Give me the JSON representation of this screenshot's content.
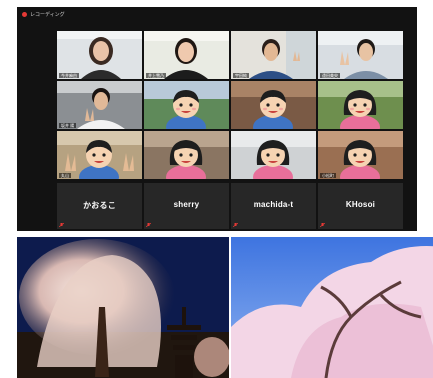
{
  "call": {
    "recording_label": "レコーディング",
    "video_tiles": [
      {
        "name": "今井麻由"
      },
      {
        "name": "井上雪乃"
      },
      {
        "name": "宇田純"
      },
      {
        "name": "遠田美央"
      },
      {
        "name": "坂井 陽"
      },
      {
        "name": ""
      },
      {
        "name": ""
      },
      {
        "name": ""
      },
      {
        "name": "丸山"
      },
      {
        "name": ""
      },
      {
        "name": ""
      },
      {
        "name": "小松町"
      }
    ],
    "name_tiles": [
      {
        "label": "かおるこ"
      },
      {
        "label": "sherry"
      },
      {
        "label": "machida-t"
      },
      {
        "label": "KHosoi"
      }
    ]
  },
  "photos": [
    {
      "subject": "weeping-cherry-tree-at-night-with-pagoda"
    },
    {
      "subject": "cherry-blossoms-against-blue-sky"
    }
  ],
  "colors": {
    "call_background": "#121212",
    "name_tile": "#272727",
    "active_speaker": "#c4d94a",
    "recording": "#e53935"
  }
}
